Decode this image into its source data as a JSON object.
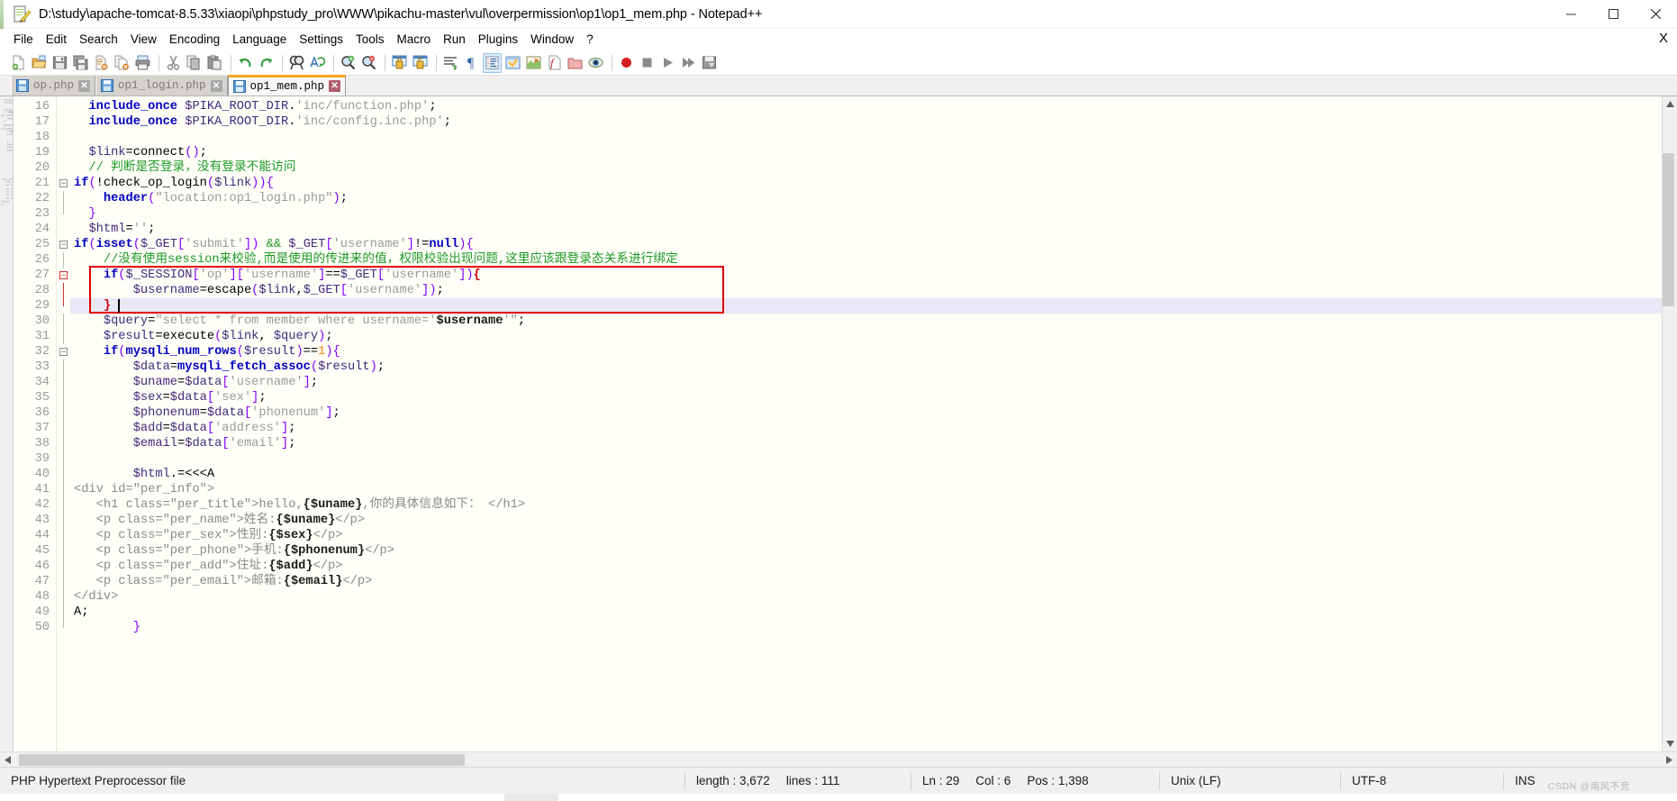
{
  "window": {
    "title": "D:\\study\\apache-tomcat-8.5.33\\xiaopi\\phpstudy_pro\\WWW\\pikachu-master\\vul\\overpermission\\op1\\op1_mem.php - Notepad++",
    "icon": "notepad-plus-plus-icon",
    "minimize": "─",
    "maximize": "□",
    "close": "✕"
  },
  "menubar": {
    "items": [
      "File",
      "Edit",
      "Search",
      "View",
      "Encoding",
      "Language",
      "Settings",
      "Tools",
      "Macro",
      "Run",
      "Plugins",
      "Window",
      "?"
    ],
    "close_document": "X"
  },
  "toolbar": {
    "buttons": [
      "new-file-icon",
      "open-file-icon",
      "save-icon",
      "save-all-icon",
      "close-file-icon",
      "close-all-icon",
      "print-icon",
      "cut-icon",
      "copy-icon",
      "paste-icon",
      "undo-icon",
      "redo-icon",
      "find-icon",
      "replace-icon",
      "zoom-in-icon",
      "zoom-out-icon",
      "sync-vertical-scroll-icon",
      "sync-horizontal-scroll-icon",
      "word-wrap-icon",
      "show-all-characters-icon",
      "show-indent-guide-icon",
      "user-defined-dialog-icon",
      "show-document-map-icon",
      "function-list-icon",
      "folder-as-workspace-icon",
      "monitoring-icon",
      "record-macro-icon",
      "stop-macro-icon",
      "play-macro-icon",
      "playback-multiple-icon",
      "save-macro-icon"
    ],
    "active_button": "show-indent-guide-icon"
  },
  "tabs": [
    {
      "label": "op.php",
      "active": false,
      "saved": true,
      "close": "✕"
    },
    {
      "label": "op1_login.php",
      "active": false,
      "saved": true,
      "close": "✕"
    },
    {
      "label": "op1_mem.php",
      "active": true,
      "saved": true,
      "close": "✕"
    }
  ],
  "editor": {
    "first_line": 16,
    "current_line": 29,
    "lines": [
      {
        "n": 16,
        "fold": "none",
        "tokens": [
          {
            "t": "kw",
            "v": "include_once"
          },
          {
            "t": "plain",
            "v": " "
          },
          {
            "t": "var",
            "v": "$PIKA_ROOT_DIR"
          },
          {
            "t": "op",
            "v": "."
          },
          {
            "t": "str",
            "v": "'inc/function.php'"
          },
          {
            "t": "op",
            "v": ";"
          }
        ],
        "indent": "  "
      },
      {
        "n": 17,
        "fold": "none",
        "tokens": [
          {
            "t": "kw",
            "v": "include_once"
          },
          {
            "t": "plain",
            "v": " "
          },
          {
            "t": "var",
            "v": "$PIKA_ROOT_DIR"
          },
          {
            "t": "op",
            "v": "."
          },
          {
            "t": "str",
            "v": "'inc/config.inc.php'"
          },
          {
            "t": "op",
            "v": ";"
          }
        ],
        "indent": "  "
      },
      {
        "n": 18,
        "fold": "none",
        "tokens": [],
        "indent": ""
      },
      {
        "n": 19,
        "fold": "none",
        "tokens": [
          {
            "t": "var",
            "v": "$link"
          },
          {
            "t": "op",
            "v": "="
          },
          {
            "t": "plain",
            "v": "connect"
          },
          {
            "t": "punc",
            "v": "()"
          },
          {
            "t": "op",
            "v": ";"
          }
        ],
        "indent": "  "
      },
      {
        "n": 20,
        "fold": "none",
        "tokens": [
          {
            "t": "cmt",
            "v": "// 判断是否登录，没有登录不能访问"
          }
        ],
        "indent": "  "
      },
      {
        "n": 21,
        "fold": "open",
        "tokens": [
          {
            "t": "kw",
            "v": "if"
          },
          {
            "t": "punc",
            "v": "("
          },
          {
            "t": "op",
            "v": "!"
          },
          {
            "t": "plain",
            "v": "check_op_login"
          },
          {
            "t": "punc",
            "v": "("
          },
          {
            "t": "var",
            "v": "$link"
          },
          {
            "t": "punc",
            "v": ")"
          },
          {
            "t": "punc",
            "v": ")"
          },
          {
            "t": "punc",
            "v": "{"
          }
        ],
        "indent": ""
      },
      {
        "n": 22,
        "fold": "mid",
        "tokens": [
          {
            "t": "kw",
            "v": "header"
          },
          {
            "t": "punc",
            "v": "("
          },
          {
            "t": "str",
            "v": "\"location:op1_login.php\""
          },
          {
            "t": "punc",
            "v": ")"
          },
          {
            "t": "op",
            "v": ";"
          }
        ],
        "indent": "    "
      },
      {
        "n": 23,
        "fold": "close",
        "tokens": [
          {
            "t": "punc",
            "v": "}"
          }
        ],
        "indent": "  "
      },
      {
        "n": 24,
        "fold": "none",
        "tokens": [
          {
            "t": "var",
            "v": "$html"
          },
          {
            "t": "op",
            "v": "="
          },
          {
            "t": "str",
            "v": "''"
          },
          {
            "t": "op",
            "v": ";"
          }
        ],
        "indent": "  "
      },
      {
        "n": 25,
        "fold": "open",
        "tokens": [
          {
            "t": "kw",
            "v": "if"
          },
          {
            "t": "punc",
            "v": "("
          },
          {
            "t": "kw",
            "v": "isset"
          },
          {
            "t": "punc",
            "v": "("
          },
          {
            "t": "var",
            "v": "$_GET"
          },
          {
            "t": "punc",
            "v": "["
          },
          {
            "t": "str",
            "v": "'submit'"
          },
          {
            "t": "punc",
            "v": "]"
          },
          {
            "t": "punc",
            "v": ")"
          },
          {
            "t": "plain",
            "v": " "
          },
          {
            "t": "cmt2",
            "v": "&&"
          },
          {
            "t": "plain",
            "v": " "
          },
          {
            "t": "var",
            "v": "$_GET"
          },
          {
            "t": "punc",
            "v": "["
          },
          {
            "t": "str",
            "v": "'username'"
          },
          {
            "t": "punc",
            "v": "]"
          },
          {
            "t": "op",
            "v": "!="
          },
          {
            "t": "kw",
            "v": "null"
          },
          {
            "t": "punc",
            "v": ")"
          },
          {
            "t": "punc",
            "v": "{"
          }
        ],
        "indent": ""
      },
      {
        "n": 26,
        "fold": "mid",
        "tokens": [
          {
            "t": "cmt",
            "v": "//没有使用session来校验,而是使用的传进来的值，权限校验出现问题,这里应该跟登录态关系进行绑定"
          }
        ],
        "indent": "    "
      },
      {
        "n": 27,
        "fold": "open-red",
        "tokens": [
          {
            "t": "kw",
            "v": "if"
          },
          {
            "t": "punc",
            "v": "("
          },
          {
            "t": "var",
            "v": "$_SESSION"
          },
          {
            "t": "punc",
            "v": "["
          },
          {
            "t": "str",
            "v": "'op'"
          },
          {
            "t": "punc",
            "v": "]"
          },
          {
            "t": "punc",
            "v": "["
          },
          {
            "t": "str",
            "v": "'username'"
          },
          {
            "t": "punc",
            "v": "]"
          },
          {
            "t": "op",
            "v": "=="
          },
          {
            "t": "var",
            "v": "$_GET"
          },
          {
            "t": "punc",
            "v": "["
          },
          {
            "t": "str",
            "v": "'username'"
          },
          {
            "t": "punc",
            "v": "]"
          },
          {
            "t": "punc",
            "v": ")"
          },
          {
            "t": "brace",
            "v": "{"
          }
        ],
        "indent": "    "
      },
      {
        "n": 28,
        "fold": "mid-red",
        "tokens": [
          {
            "t": "var",
            "v": "$username"
          },
          {
            "t": "op",
            "v": "="
          },
          {
            "t": "plain",
            "v": "escape"
          },
          {
            "t": "punc",
            "v": "("
          },
          {
            "t": "var",
            "v": "$link"
          },
          {
            "t": "op",
            "v": ","
          },
          {
            "t": "var",
            "v": "$_GET"
          },
          {
            "t": "punc",
            "v": "["
          },
          {
            "t": "str",
            "v": "'username'"
          },
          {
            "t": "punc",
            "v": "]"
          },
          {
            "t": "punc",
            "v": ")"
          },
          {
            "t": "op",
            "v": ";"
          }
        ],
        "indent": "        "
      },
      {
        "n": 29,
        "fold": "close-red",
        "tokens": [
          {
            "t": "brace",
            "v": "}"
          }
        ],
        "indent": "    "
      },
      {
        "n": 30,
        "fold": "mid",
        "tokens": [
          {
            "t": "var",
            "v": "$query"
          },
          {
            "t": "op",
            "v": "="
          },
          {
            "t": "str",
            "v": "\"select * from member where username='"
          },
          {
            "t": "strb",
            "v": "$username"
          },
          {
            "t": "str",
            "v": "'\""
          },
          {
            "t": "op",
            "v": ";"
          }
        ],
        "indent": "    "
      },
      {
        "n": 31,
        "fold": "mid",
        "tokens": [
          {
            "t": "var",
            "v": "$result"
          },
          {
            "t": "op",
            "v": "="
          },
          {
            "t": "plain",
            "v": "execute"
          },
          {
            "t": "punc",
            "v": "("
          },
          {
            "t": "var",
            "v": "$link"
          },
          {
            "t": "op",
            "v": ","
          },
          {
            "t": "plain",
            "v": " "
          },
          {
            "t": "var",
            "v": "$query"
          },
          {
            "t": "punc",
            "v": ")"
          },
          {
            "t": "op",
            "v": ";"
          }
        ],
        "indent": "    "
      },
      {
        "n": 32,
        "fold": "open",
        "tokens": [
          {
            "t": "kw",
            "v": "if"
          },
          {
            "t": "punc",
            "v": "("
          },
          {
            "t": "fn",
            "v": "mysqli_num_rows"
          },
          {
            "t": "punc",
            "v": "("
          },
          {
            "t": "var",
            "v": "$result"
          },
          {
            "t": "punc",
            "v": ")"
          },
          {
            "t": "op",
            "v": "=="
          },
          {
            "t": "num",
            "v": "1"
          },
          {
            "t": "punc",
            "v": ")"
          },
          {
            "t": "punc",
            "v": "{"
          }
        ],
        "indent": "    "
      },
      {
        "n": 33,
        "fold": "mid",
        "tokens": [
          {
            "t": "var",
            "v": "$data"
          },
          {
            "t": "op",
            "v": "="
          },
          {
            "t": "fn",
            "v": "mysqli_fetch_assoc"
          },
          {
            "t": "punc",
            "v": "("
          },
          {
            "t": "var",
            "v": "$result"
          },
          {
            "t": "punc",
            "v": ")"
          },
          {
            "t": "op",
            "v": ";"
          }
        ],
        "indent": "        "
      },
      {
        "n": 34,
        "fold": "mid",
        "tokens": [
          {
            "t": "var",
            "v": "$uname"
          },
          {
            "t": "op",
            "v": "="
          },
          {
            "t": "var",
            "v": "$data"
          },
          {
            "t": "punc",
            "v": "["
          },
          {
            "t": "str",
            "v": "'username'"
          },
          {
            "t": "punc",
            "v": "]"
          },
          {
            "t": "op",
            "v": ";"
          }
        ],
        "indent": "        "
      },
      {
        "n": 35,
        "fold": "mid",
        "tokens": [
          {
            "t": "var",
            "v": "$sex"
          },
          {
            "t": "op",
            "v": "="
          },
          {
            "t": "var",
            "v": "$data"
          },
          {
            "t": "punc",
            "v": "["
          },
          {
            "t": "str",
            "v": "'sex'"
          },
          {
            "t": "punc",
            "v": "]"
          },
          {
            "t": "op",
            "v": ";"
          }
        ],
        "indent": "        "
      },
      {
        "n": 36,
        "fold": "mid",
        "tokens": [
          {
            "t": "var",
            "v": "$phonenum"
          },
          {
            "t": "op",
            "v": "="
          },
          {
            "t": "var",
            "v": "$data"
          },
          {
            "t": "punc",
            "v": "["
          },
          {
            "t": "str",
            "v": "'phonenum'"
          },
          {
            "t": "punc",
            "v": "]"
          },
          {
            "t": "op",
            "v": ";"
          }
        ],
        "indent": "        "
      },
      {
        "n": 37,
        "fold": "mid",
        "tokens": [
          {
            "t": "var",
            "v": "$add"
          },
          {
            "t": "op",
            "v": "="
          },
          {
            "t": "var",
            "v": "$data"
          },
          {
            "t": "punc",
            "v": "["
          },
          {
            "t": "str",
            "v": "'address'"
          },
          {
            "t": "punc",
            "v": "]"
          },
          {
            "t": "op",
            "v": ";"
          }
        ],
        "indent": "        "
      },
      {
        "n": 38,
        "fold": "mid",
        "tokens": [
          {
            "t": "var",
            "v": "$email"
          },
          {
            "t": "op",
            "v": "="
          },
          {
            "t": "var",
            "v": "$data"
          },
          {
            "t": "punc",
            "v": "["
          },
          {
            "t": "str",
            "v": "'email'"
          },
          {
            "t": "punc",
            "v": "]"
          },
          {
            "t": "op",
            "v": ";"
          }
        ],
        "indent": "        "
      },
      {
        "n": 39,
        "fold": "mid",
        "tokens": [],
        "indent": ""
      },
      {
        "n": 40,
        "fold": "mid",
        "tokens": [
          {
            "t": "var",
            "v": "$html"
          },
          {
            "t": "op",
            "v": ".="
          },
          {
            "t": "plain",
            "v": "<<<A"
          }
        ],
        "indent": "        "
      },
      {
        "n": 41,
        "fold": "mid",
        "tokens": [
          {
            "t": "html",
            "v": "<div id=\"per_info\">"
          }
        ],
        "indent": ""
      },
      {
        "n": 42,
        "fold": "mid",
        "tokens": [
          {
            "t": "html",
            "v": "<h1 class=\"per_title\">hello,"
          },
          {
            "t": "strb",
            "v": "{$uname}"
          },
          {
            "t": "html",
            "v": ",你的具体信息如下： </h1>"
          }
        ],
        "indent": "   "
      },
      {
        "n": 43,
        "fold": "mid",
        "tokens": [
          {
            "t": "html",
            "v": "<p class=\"per_name\">姓名:"
          },
          {
            "t": "strb",
            "v": "{$uname}"
          },
          {
            "t": "html",
            "v": "</p>"
          }
        ],
        "indent": "   "
      },
      {
        "n": 44,
        "fold": "mid",
        "tokens": [
          {
            "t": "html",
            "v": "<p class=\"per_sex\">性别:"
          },
          {
            "t": "strb",
            "v": "{$sex}"
          },
          {
            "t": "html",
            "v": "</p>"
          }
        ],
        "indent": "   "
      },
      {
        "n": 45,
        "fold": "mid",
        "tokens": [
          {
            "t": "html",
            "v": "<p class=\"per_phone\">手机:"
          },
          {
            "t": "strb",
            "v": "{$phonenum}"
          },
          {
            "t": "html",
            "v": "</p>"
          }
        ],
        "indent": "   "
      },
      {
        "n": 46,
        "fold": "mid",
        "tokens": [
          {
            "t": "html",
            "v": "<p class=\"per_add\">住址:"
          },
          {
            "t": "strb",
            "v": "{$add}"
          },
          {
            "t": "html",
            "v": "</p>"
          }
        ],
        "indent": "   "
      },
      {
        "n": 47,
        "fold": "mid",
        "tokens": [
          {
            "t": "html",
            "v": "<p class=\"per_email\">邮箱:"
          },
          {
            "t": "strb",
            "v": "{$email}"
          },
          {
            "t": "html",
            "v": "</p>"
          }
        ],
        "indent": "   "
      },
      {
        "n": 48,
        "fold": "mid",
        "tokens": [
          {
            "t": "html",
            "v": "</div>"
          }
        ],
        "indent": ""
      },
      {
        "n": 49,
        "fold": "mid",
        "tokens": [
          {
            "t": "plain",
            "v": "A;"
          }
        ],
        "indent": ""
      },
      {
        "n": 50,
        "fold": "close",
        "tokens": [
          {
            "t": "punc",
            "v": "}"
          }
        ],
        "indent": "        "
      }
    ]
  },
  "statusbar": {
    "file_type": "PHP Hypertext Preprocessor file",
    "length_label": "length : 3,672",
    "lines_label": "lines : 111",
    "ln": "Ln : 29",
    "col": "Col : 6",
    "pos": "Pos : 1,398",
    "eol": "Unix (LF)",
    "encoding": "UTF-8",
    "insert_mode": "INS",
    "watermark": "CSDN @南风不竞"
  }
}
